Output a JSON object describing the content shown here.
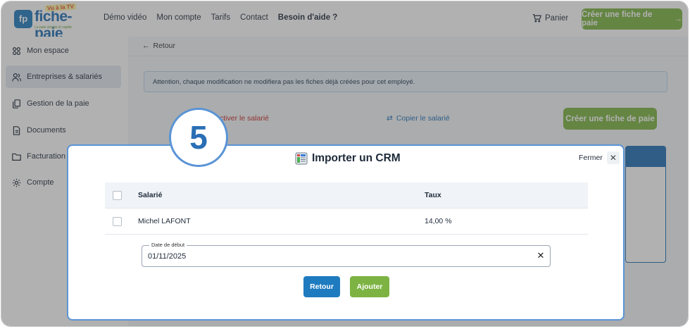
{
  "logo": {
    "badge": "fp",
    "name": "fiche-paie",
    "tag": "Vu à la TV",
    "tagline": "La paie simple et rapide"
  },
  "nav": {
    "items": [
      "Démo vidéo",
      "Mon compte",
      "Tarifs",
      "Contact"
    ],
    "help": "Besoin d'aide ?"
  },
  "header": {
    "cart_label": "Panier",
    "cta_label": "Créer une fiche de paie"
  },
  "sidebar": {
    "items": [
      {
        "label": "Mon espace",
        "icon": "dashboard-icon"
      },
      {
        "label": "Entreprises & salariés",
        "icon": "users-icon",
        "active": true
      },
      {
        "label": "Gestion de la paie",
        "icon": "payroll-icon"
      },
      {
        "label": "Documents",
        "icon": "document-icon"
      },
      {
        "label": "Facturation",
        "icon": "folder-icon"
      },
      {
        "label": "Compte",
        "icon": "gear-icon"
      }
    ]
  },
  "main": {
    "back_label": "Retour",
    "alert": "Attention, chaque modification ne modifiera pas les fiches déjà créées pour cet employé.",
    "deactivate_label": "Désactiver le salarié",
    "deactivate_visible": "ctiver le salarié",
    "copy_label": "Copier le salarié",
    "cta_label": "Créer une fiche de paie"
  },
  "step": {
    "number": "5"
  },
  "modal": {
    "title": "Importer un CRM",
    "close_label": "Fermer",
    "table": {
      "headers": [
        "Salarié",
        "Taux"
      ],
      "rows": [
        {
          "name": "Michel LAFONT",
          "taux": "14,00 %"
        }
      ]
    },
    "date_field": {
      "label": "Date de début",
      "value": "01/11/2025"
    },
    "buttons": {
      "back": "Retour",
      "add": "Ajouter"
    }
  },
  "colors": {
    "primary": "#1f7bbf",
    "accent_green": "#7cb342",
    "danger": "#c62828",
    "modal_border": "#5a94d6"
  }
}
